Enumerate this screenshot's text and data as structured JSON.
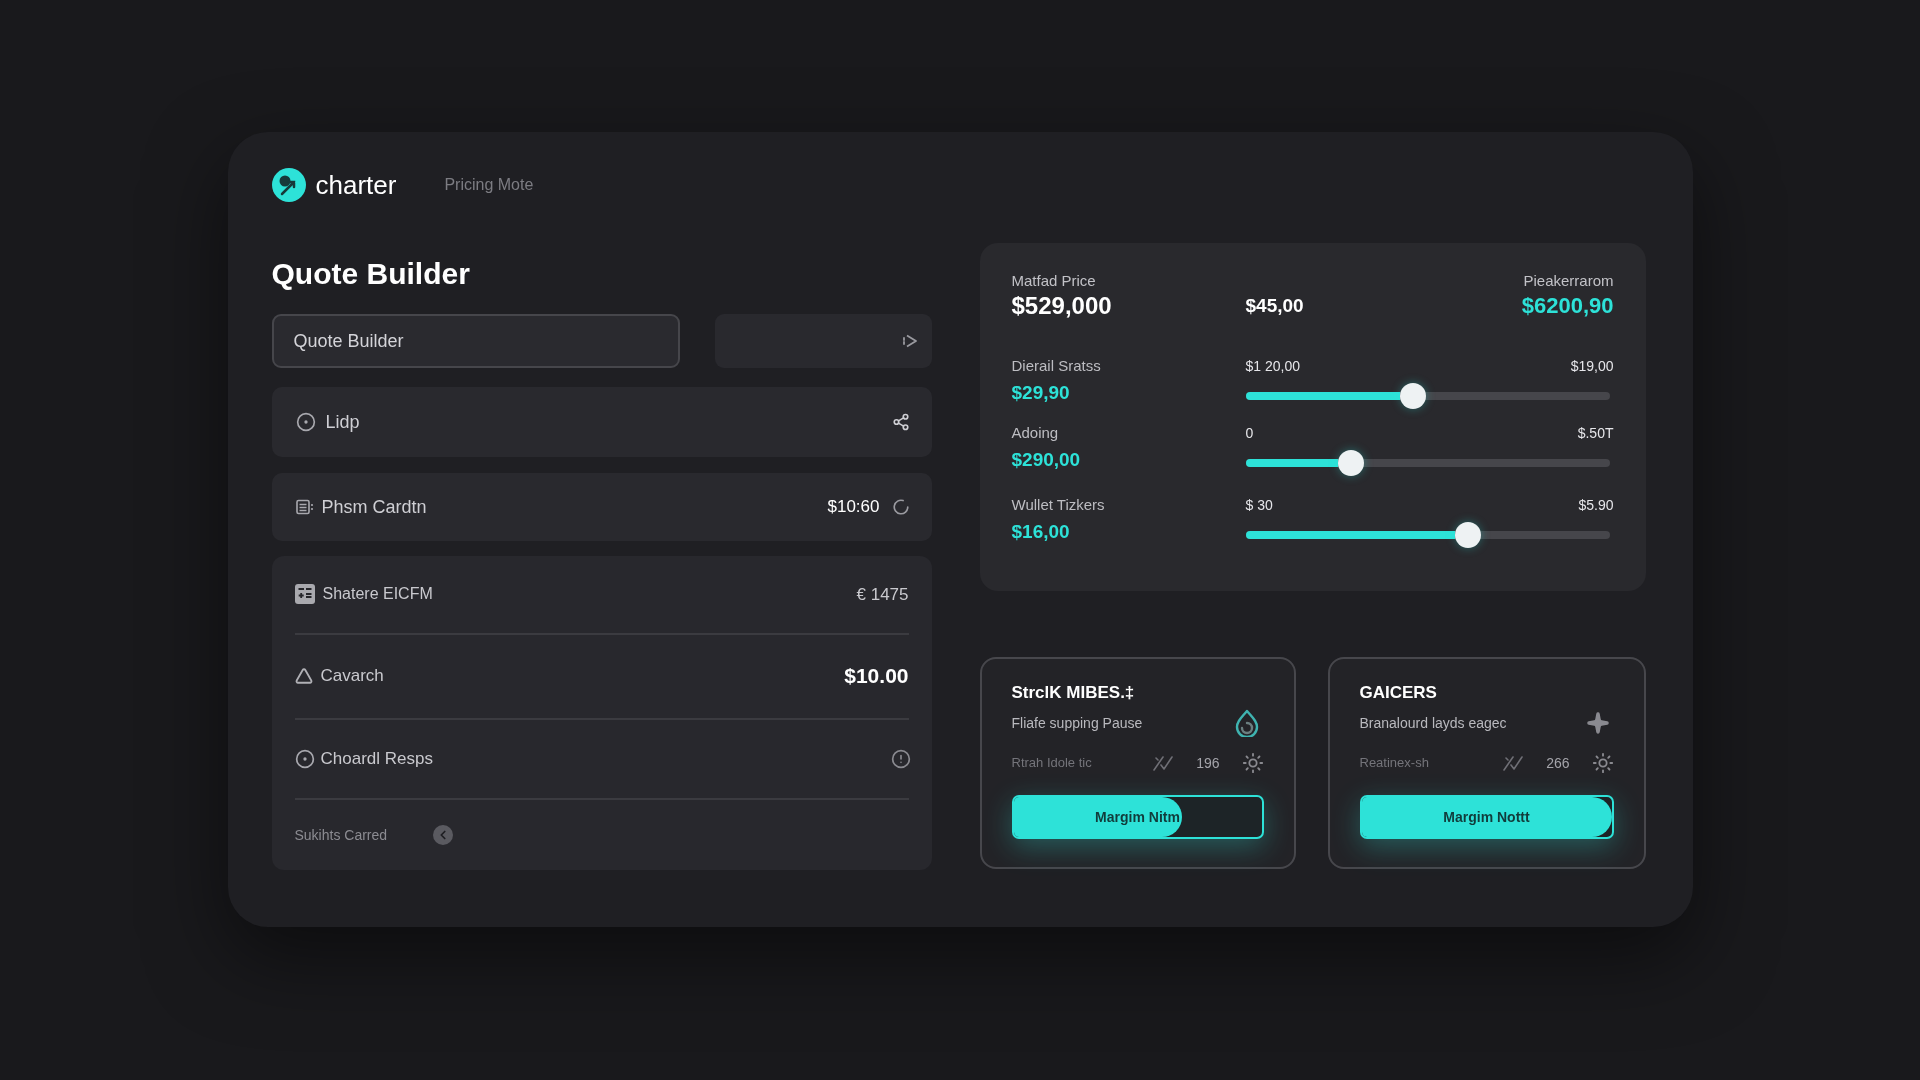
{
  "header": {
    "brand": "charter",
    "mode": "Pricing Mote"
  },
  "builder": {
    "title": "Quote Builder",
    "name_field": {
      "value": "Quote Builder"
    },
    "options": [
      {
        "kind": "select",
        "label": "Lidp"
      },
      {
        "kind": "amount",
        "label": "Phsm Cardtn",
        "value": "$10:60"
      }
    ],
    "breakdown": [
      {
        "kind": "amount",
        "label": "Shatere EICFM",
        "value": "€ 1475"
      },
      {
        "kind": "total",
        "label": "Cavarch",
        "value": "$10.00"
      },
      {
        "kind": "info",
        "label": "Choardl Resps"
      },
      {
        "kind": "note",
        "label": "Sukihts Carred"
      }
    ]
  },
  "summary": {
    "base": {
      "label": "Matfad Price",
      "value": "$529,000"
    },
    "delta": {
      "value": "$45,00"
    },
    "peak": {
      "label": "Pieakerrarom",
      "value": "$6200,90"
    },
    "sliders": [
      {
        "label": "Dierail Sratss",
        "value": "$29,90",
        "min": "$1 20,00",
        "max": "$19,00",
        "level": 0.46
      },
      {
        "label": "Adoing",
        "value": "$290,00",
        "min": "0",
        "max": "$.50T",
        "level": 0.29
      },
      {
        "label": "Wullet Tizkers",
        "value": "$16,00",
        "min": "$ 30",
        "max": "$5.90",
        "level": 0.61
      }
    ]
  },
  "cards": [
    {
      "title": "StrclK MIBES.‡",
      "subtitle": "Fliafe supping Pause",
      "stat_label": "Rtrah Idole tic",
      "count": "196",
      "button": {
        "label": "Margim Nitm",
        "level": 0.68
      }
    },
    {
      "title": "GAICERS",
      "subtitle": "Branalourd layds eagec",
      "stat_label": "Reatinex-sh",
      "count": "266",
      "button": {
        "label": "Margim Nottt",
        "level": 1
      }
    }
  ]
}
